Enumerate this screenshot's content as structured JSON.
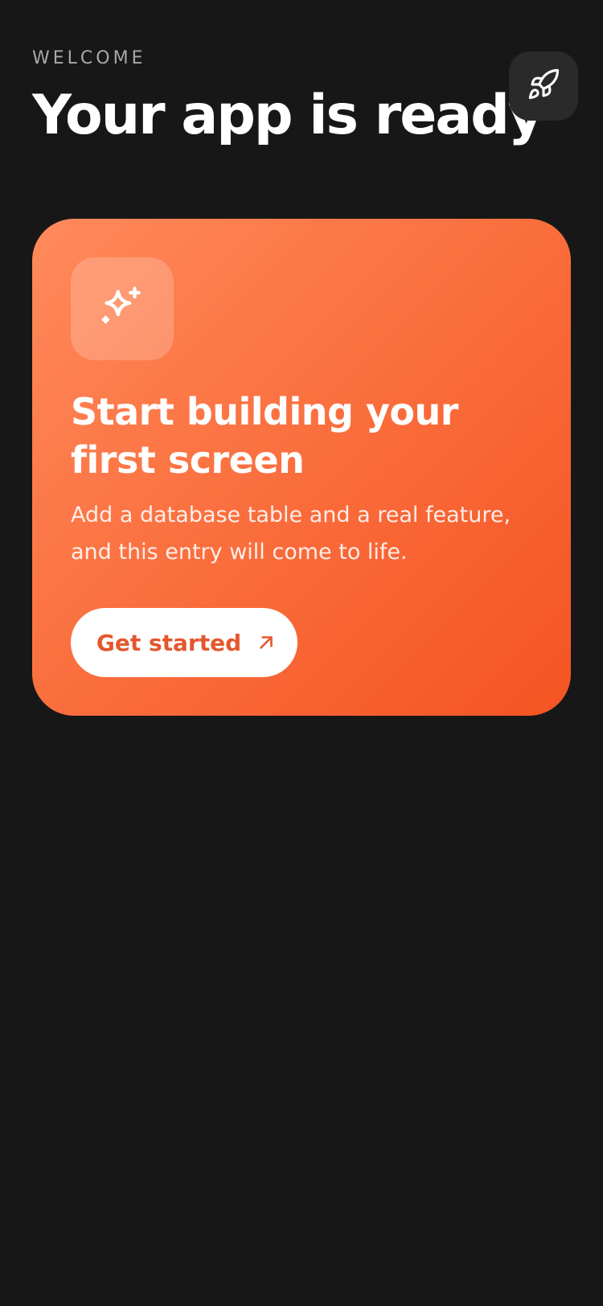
{
  "header": {
    "eyebrow": "WELCOME",
    "title": "Your app is ready",
    "action_icon": "rocket-icon"
  },
  "card": {
    "icon": "sparkles-icon",
    "title": "Start building your first screen",
    "body": "Add a database table and a real feature, and this entry will come to life.",
    "cta_label": "Get started",
    "cta_icon": "arrow-up-right-icon"
  },
  "colors": {
    "background": "#171717",
    "accent": "#f35422",
    "accent_light": "#ff8a5b",
    "cta_text": "#e4572e",
    "muted": "#a8a8a8"
  }
}
